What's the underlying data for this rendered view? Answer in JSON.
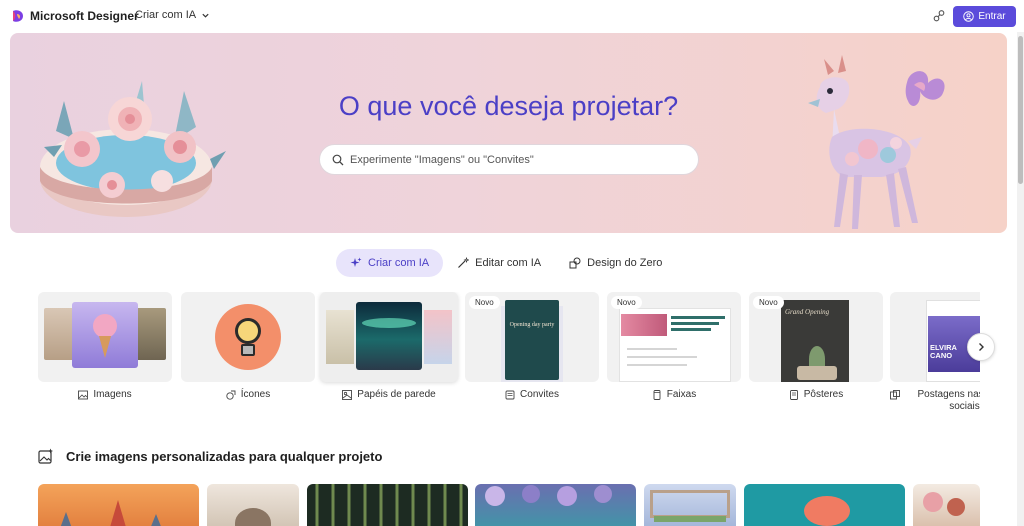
{
  "topbar": {
    "brand": "Microsoft Designer",
    "ai_menu_label": "Criar com IA",
    "login_label": "Entrar"
  },
  "hero": {
    "title": "O que você deseja projetar?",
    "search_placeholder": "Experimente \"Imagens\" ou \"Convites\"",
    "search_value": ""
  },
  "tabs": [
    {
      "label": "Criar com IA",
      "icon": "sparkle-icon",
      "active": true
    },
    {
      "label": "Editar com IA",
      "icon": "magic-wand-icon",
      "active": false
    },
    {
      "label": "Design do Zero",
      "icon": "shapes-icon",
      "active": false
    }
  ],
  "cards": [
    {
      "label": "Imagens",
      "icon": "image-icon",
      "badge": ""
    },
    {
      "label": "Ícones",
      "icon": "icons-icon",
      "badge": ""
    },
    {
      "label": "Papéis de parede",
      "icon": "wallpaper-icon",
      "badge": ""
    },
    {
      "label": "Convites",
      "icon": "invitation-icon",
      "badge": "Novo",
      "card_text": "Opening day party"
    },
    {
      "label": "Faixas",
      "icon": "banner-icon",
      "badge": "Novo"
    },
    {
      "label": "Pôsteres",
      "icon": "poster-icon",
      "badge": "Novo",
      "card_text": "Grand Opening"
    },
    {
      "label": "Postagens nas redes sociais",
      "icon": "social-post-icon",
      "badge": "",
      "card_text": "ELVIRA CANO"
    }
  ],
  "section": {
    "title": "Crie imagens personalizadas para qualquer projeto",
    "icon": "image-sparkle-icon"
  },
  "colors": {
    "accent": "#5b4bdb",
    "title": "#4b3fc6",
    "tab_active_bg": "#e8e4fb"
  }
}
